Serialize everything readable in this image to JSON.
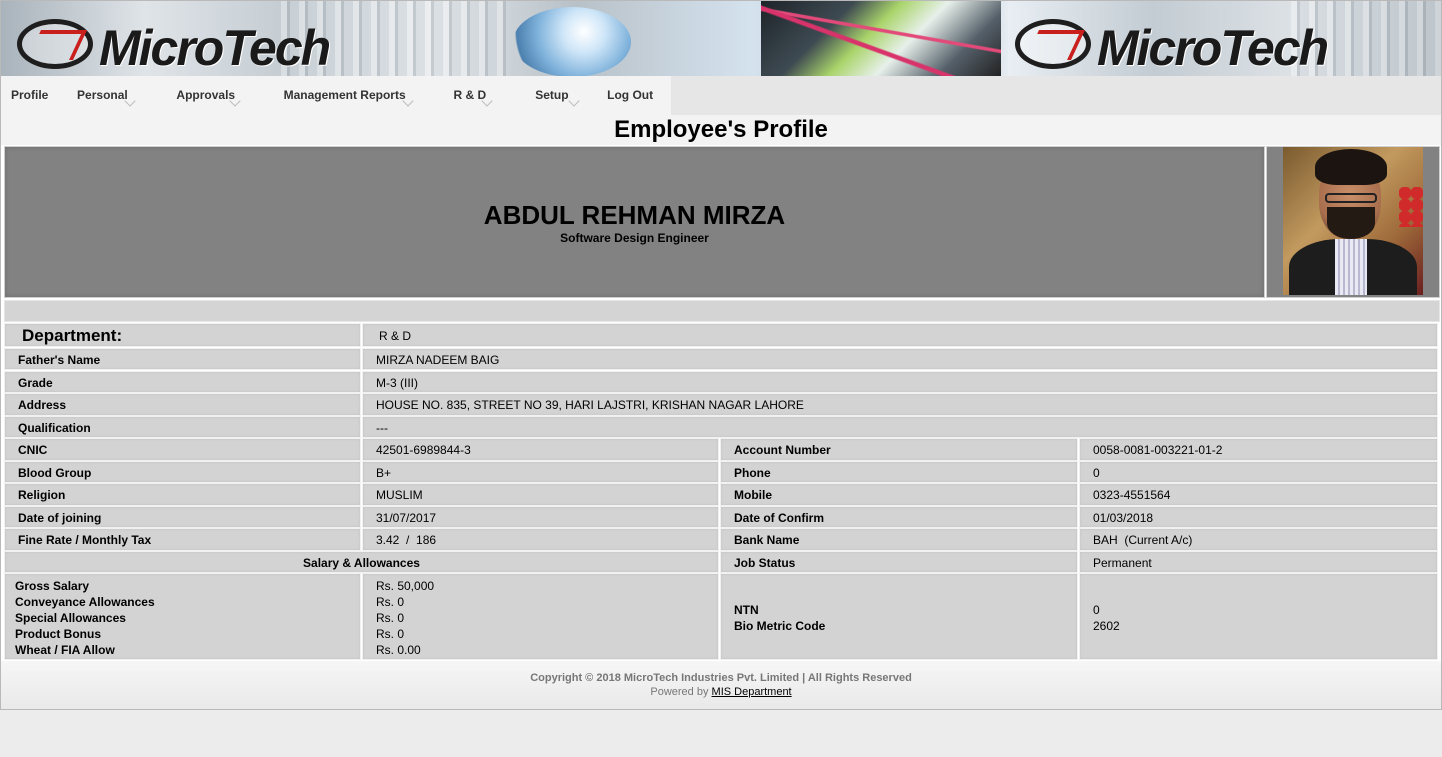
{
  "banner": {
    "logo_text": "MicroTech"
  },
  "menu": {
    "items": [
      {
        "label": "Profile",
        "has_dropdown": false
      },
      {
        "label": "Personal",
        "has_dropdown": true
      },
      {
        "label": "Approvals",
        "has_dropdown": true
      },
      {
        "label": "Management Reports",
        "has_dropdown": true
      },
      {
        "label": "R & D",
        "has_dropdown": true
      },
      {
        "label": "Setup",
        "has_dropdown": true
      },
      {
        "label": "Log Out",
        "has_dropdown": false
      }
    ]
  },
  "page": {
    "title": "Employee's Profile"
  },
  "employee": {
    "name": "ABDUL REHMAN MIRZA",
    "designation": "Software Design Engineer",
    "department_label": "Department:",
    "department": "R & D",
    "fathers_name_label": "Father's Name",
    "fathers_name": "MIRZA NADEEM BAIG",
    "grade_label": "Grade",
    "grade": "M-3 (III)",
    "address_label": "Address",
    "address": "HOUSE NO. 835, STREET NO 39, HARI LAJSTRI, KRISHAN NAGAR LAHORE",
    "qualification_label": "Qualification",
    "qualification": "---"
  },
  "details": {
    "left": [
      {
        "label": "CNIC",
        "value": "42501-6989844-3"
      },
      {
        "label": "Blood Group",
        "value": "B+"
      },
      {
        "label": "Religion",
        "value": "MUSLIM"
      },
      {
        "label": "Date of joining",
        "value": "31/07/2017"
      },
      {
        "label": "Fine Rate / Monthly Tax",
        "value": "3.42  /  186"
      }
    ],
    "right": [
      {
        "label": "Account Number",
        "value": "0058-0081-003221-01-2"
      },
      {
        "label": "Phone",
        "value": "0"
      },
      {
        "label": "Mobile",
        "value": "0323-4551564"
      },
      {
        "label": "Date of Confirm",
        "value": "01/03/2018"
      },
      {
        "label": "Bank Name",
        "value": "BAH  (Current A/c)"
      }
    ]
  },
  "salary": {
    "heading": "Salary & Allowances",
    "job_status_label": "Job Status",
    "job_status": "Permanent",
    "items": [
      {
        "label": "Gross Salary",
        "value": "Rs. 50,000"
      },
      {
        "label": "Conveyance Allowances",
        "value": "Rs. 0"
      },
      {
        "label": "Special Allowances",
        "value": "Rs. 0"
      },
      {
        "label": "Product Bonus",
        "value": "Rs. 0"
      },
      {
        "label": "Wheat / FIA Allow",
        "value": "Rs. 0.00"
      }
    ],
    "ntn_label": "NTN",
    "ntn": "0",
    "bio_label": "Bio Metric Code",
    "bio": "2602"
  },
  "footer": {
    "copyright": "Copyright © 2018 MicroTech Industries Pvt. Limited | All Rights Reserved",
    "powered_prefix": "Powered by",
    "powered_link": "MIS Department"
  }
}
